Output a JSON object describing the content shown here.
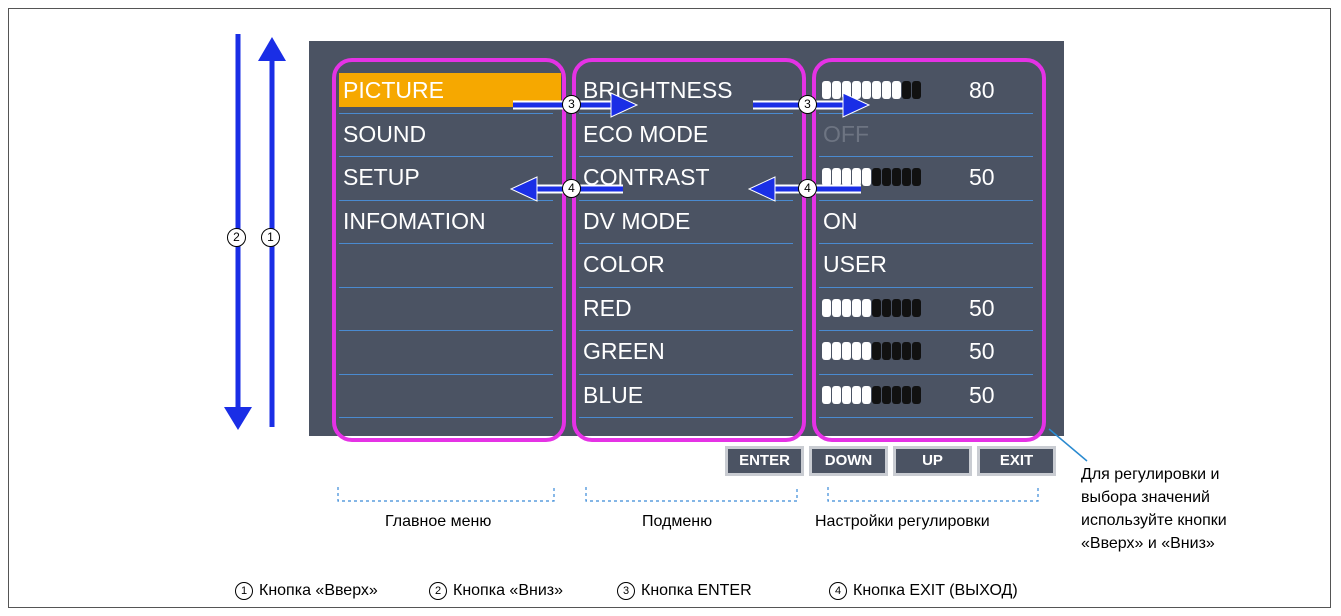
{
  "main_menu": {
    "items": [
      "PICTURE",
      "SOUND",
      "SETUP",
      "INFOMATION"
    ],
    "selected": "PICTURE",
    "caption": "Главное меню"
  },
  "submenu": {
    "items": [
      "BRIGHTNESS",
      "ECO MODE",
      "CONTRAST",
      "DV MODE",
      "COLOR",
      "RED",
      "GREEN",
      "BLUE"
    ],
    "caption": "Подменю"
  },
  "adjustments": {
    "caption": "Настройки регулировки",
    "rows": [
      {
        "type": "bar",
        "value": "80",
        "level": 0.8
      },
      {
        "type": "text",
        "value": "OFF",
        "dimmed": true
      },
      {
        "type": "bar",
        "value": "50",
        "level": 0.5
      },
      {
        "type": "text",
        "value": "ON"
      },
      {
        "type": "text",
        "value": "USER"
      },
      {
        "type": "bar",
        "value": "50",
        "level": 0.5
      },
      {
        "type": "bar",
        "value": "50",
        "level": 0.5
      },
      {
        "type": "bar",
        "value": "50",
        "level": 0.5
      }
    ]
  },
  "buttons": [
    "ENTER",
    "DOWN",
    "UP",
    "EXIT"
  ],
  "note_lines": [
    "Для регулировки и",
    "выбора значений",
    "используйте кнопки",
    "«Вверх» и «Вниз»"
  ],
  "markers": {
    "up": "1",
    "down": "2",
    "enter": "3",
    "exit": "4"
  },
  "legend": [
    {
      "num": "1",
      "label": "Кнопка «Вверх»"
    },
    {
      "num": "2",
      "label": "Кнопка «Вниз»"
    },
    {
      "num": "3",
      "label": "Кнопка ENTER"
    },
    {
      "num": "4",
      "label": "Кнопка EXIT (ВЫХОД)"
    }
  ],
  "colors": {
    "osd_background": "#4b5363",
    "selection": "#f6a800",
    "column_outline": "#e532e5",
    "arrow": "#1a2ee6",
    "row_divider": "#4a8ad0"
  }
}
